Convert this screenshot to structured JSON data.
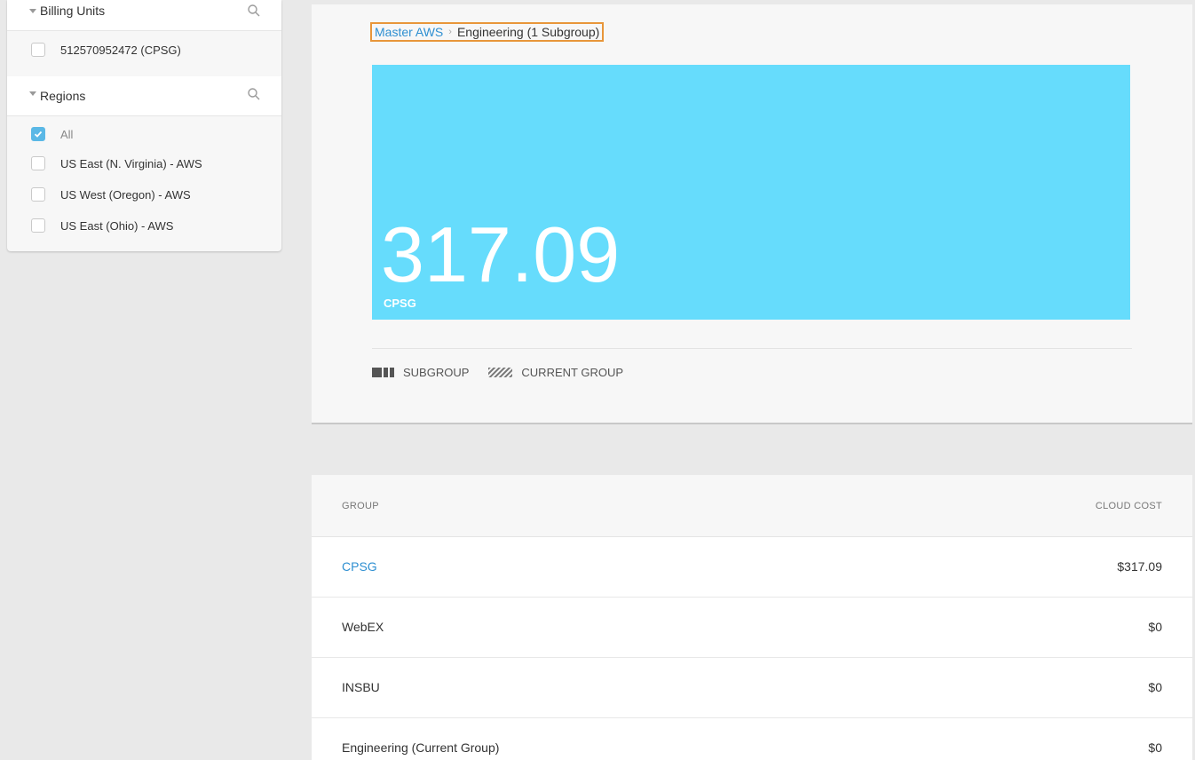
{
  "filters": {
    "billing_units": {
      "title": "Billing Units",
      "items": [
        {
          "label": "512570952472 (CPSG)",
          "checked": false
        }
      ]
    },
    "regions": {
      "title": "Regions",
      "items": [
        {
          "label": "All",
          "checked": true
        },
        {
          "label": "US East (N. Virginia) - AWS",
          "checked": false
        },
        {
          "label": "US West (Oregon) - AWS",
          "checked": false
        },
        {
          "label": "US East (Ohio) - AWS",
          "checked": false
        }
      ]
    }
  },
  "breadcrumb": {
    "root": "Master AWS",
    "current": "Engineering (1 Subgroup)"
  },
  "treemap": {
    "value": "317.09",
    "label": "CPSG",
    "color": "#66dcfc"
  },
  "legend": {
    "subgroup": "SUBGROUP",
    "current_group": "CURRENT GROUP"
  },
  "table": {
    "headers": {
      "group": "GROUP",
      "cost": "CLOUD COST"
    },
    "rows": [
      {
        "group": "CPSG",
        "cost": "$317.09",
        "link": true
      },
      {
        "group": "WebEX",
        "cost": "$0",
        "link": false
      },
      {
        "group": "INSBU",
        "cost": "$0",
        "link": false
      },
      {
        "group": "Engineering (Current Group)",
        "cost": "$0",
        "link": false
      }
    ]
  },
  "colors": {
    "accent": "#2e8fd1",
    "checkbox": "#5ab8e6",
    "highlight": "#e8963a"
  }
}
